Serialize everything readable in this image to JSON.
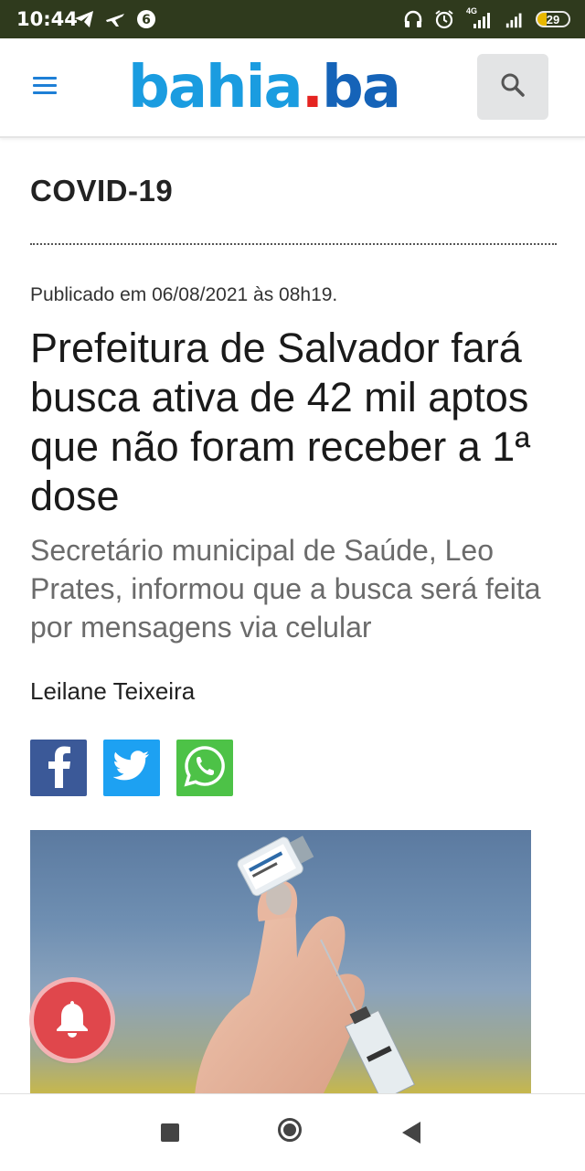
{
  "status_bar": {
    "time": "10:44",
    "network": "4G",
    "battery": "29"
  },
  "header": {
    "logo_part1": "bahia",
    "logo_dot": ".",
    "logo_part2": "ba"
  },
  "article": {
    "section": "COVID-19",
    "published": "Publicado em 06/08/2021 às 08h19.",
    "headline": "Prefeitura de Salvador fará busca ativa de 42 mil aptos que não foram receber a 1ª dose",
    "subtitle": "Secretário municipal de Saúde, Leo Prates, informou que a busca será feita por mensagens via celular",
    "author": "Leilane Teixeira"
  },
  "colors": {
    "status_bar_bg": "#2f3a1d",
    "logo_light_blue": "#1a9ce0",
    "logo_red_dot": "#e52421",
    "logo_dark_blue": "#1563b8",
    "facebook": "#3b5998",
    "twitter": "#1da1f2",
    "whatsapp": "#4dc247",
    "notification_bell": "#e0474c"
  },
  "icons": [
    "telegram-icon",
    "airplane-icon",
    "notification-icon",
    "headphones-icon",
    "alarm-icon",
    "signal-icon",
    "battery-icon",
    "menu-icon",
    "search-icon",
    "facebook-icon",
    "twitter-icon",
    "whatsapp-icon",
    "bell-icon",
    "recent-apps-icon",
    "home-icon",
    "back-icon"
  ]
}
